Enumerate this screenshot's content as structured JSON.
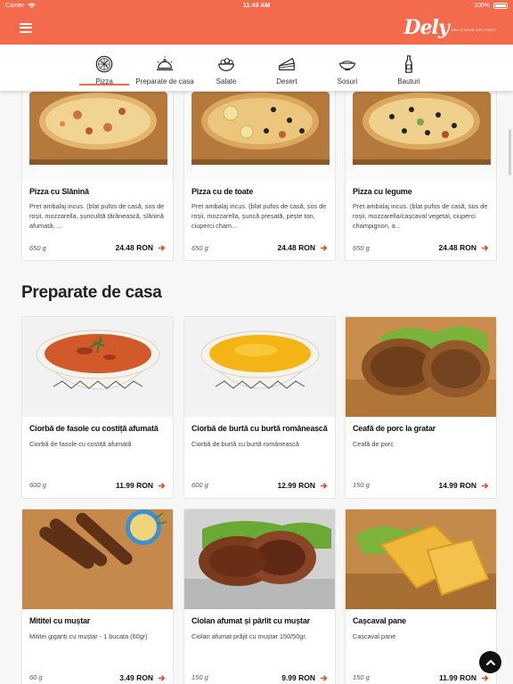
{
  "status_bar": {
    "carrier": "Carrier",
    "time": "11:49 AM",
    "battery": "100%"
  },
  "header": {
    "logo": "Dely",
    "logo_tagline": "DELICIOUS DELIVERY"
  },
  "categories": [
    {
      "label": "Pizza",
      "icon": "pizza-icon",
      "active": true
    },
    {
      "label": "Preparate de casa",
      "icon": "cloche-icon"
    },
    {
      "label": "Salate",
      "icon": "salad-bowl-icon"
    },
    {
      "label": "Desert",
      "icon": "cake-slice-icon"
    },
    {
      "label": "Sosuri",
      "icon": "sauce-bowl-icon"
    },
    {
      "label": "Bauturi",
      "icon": "bottle-icon"
    }
  ],
  "pizza_items": [
    {
      "name": "Pizza cu Slănină",
      "desc": "Pret ambalaj incus. (blat pufos de casă, sos de roșii, mozzarella, șunculiță țărănească, slănină afumată, ...",
      "weight": "650 g",
      "price": "24.48 RON"
    },
    {
      "name": "Pizza cu de toate",
      "desc": "Pret ambalaj incus. (blat pufos de casă, sos de roșii, mozzarella, șuncă presată, pește ton, ciuperci cham...",
      "weight": "650 g",
      "price": "24.48 RON"
    },
    {
      "name": "Pizza cu legume",
      "desc": "Pret ambalaj incus. (blat pufos de casă, sos de roșii, mozzarella/cașcaval vegetal, ciuperci champignon, a...",
      "weight": "650 g",
      "price": "24.48 RON"
    }
  ],
  "section_title": "Preparate de casa",
  "casa_items": [
    {
      "name": "Ciorbă de fasole cu costiță afumată",
      "desc": "Ciorbă de fasole cu costiță afumată",
      "weight": "600 g",
      "price": "11.99 RON"
    },
    {
      "name": "Ciorbă de burtă cu burtă românească",
      "desc": "Ciorbă de burtă cu burtă românească",
      "weight": "600 g",
      "price": "12.99 RON"
    },
    {
      "name": "Ceafă de porc la gratar",
      "desc": "Ceafă de porc",
      "weight": "150 g",
      "price": "14.99 RON"
    },
    {
      "name": "Mititei cu muștar",
      "desc": "Mititei giganți cu muștar - 1 bucata (60gr)",
      "weight": "60 g",
      "price": "3.49 RON"
    },
    {
      "name": "Ciolan afumat și pârlit cu muștar",
      "desc": "Ciolan afumat prăjit cu muștar 150/50gr.",
      "weight": "150 g",
      "price": "9.99 RON"
    },
    {
      "name": "Cașcaval pane",
      "desc": "Cașcaval pane",
      "weight": "150 g",
      "price": "11.99 RON"
    }
  ],
  "colors": {
    "brand": "#f46a4c",
    "price_arrow": "#e8492b"
  },
  "scroll_top_icon": "chevron-up-icon"
}
